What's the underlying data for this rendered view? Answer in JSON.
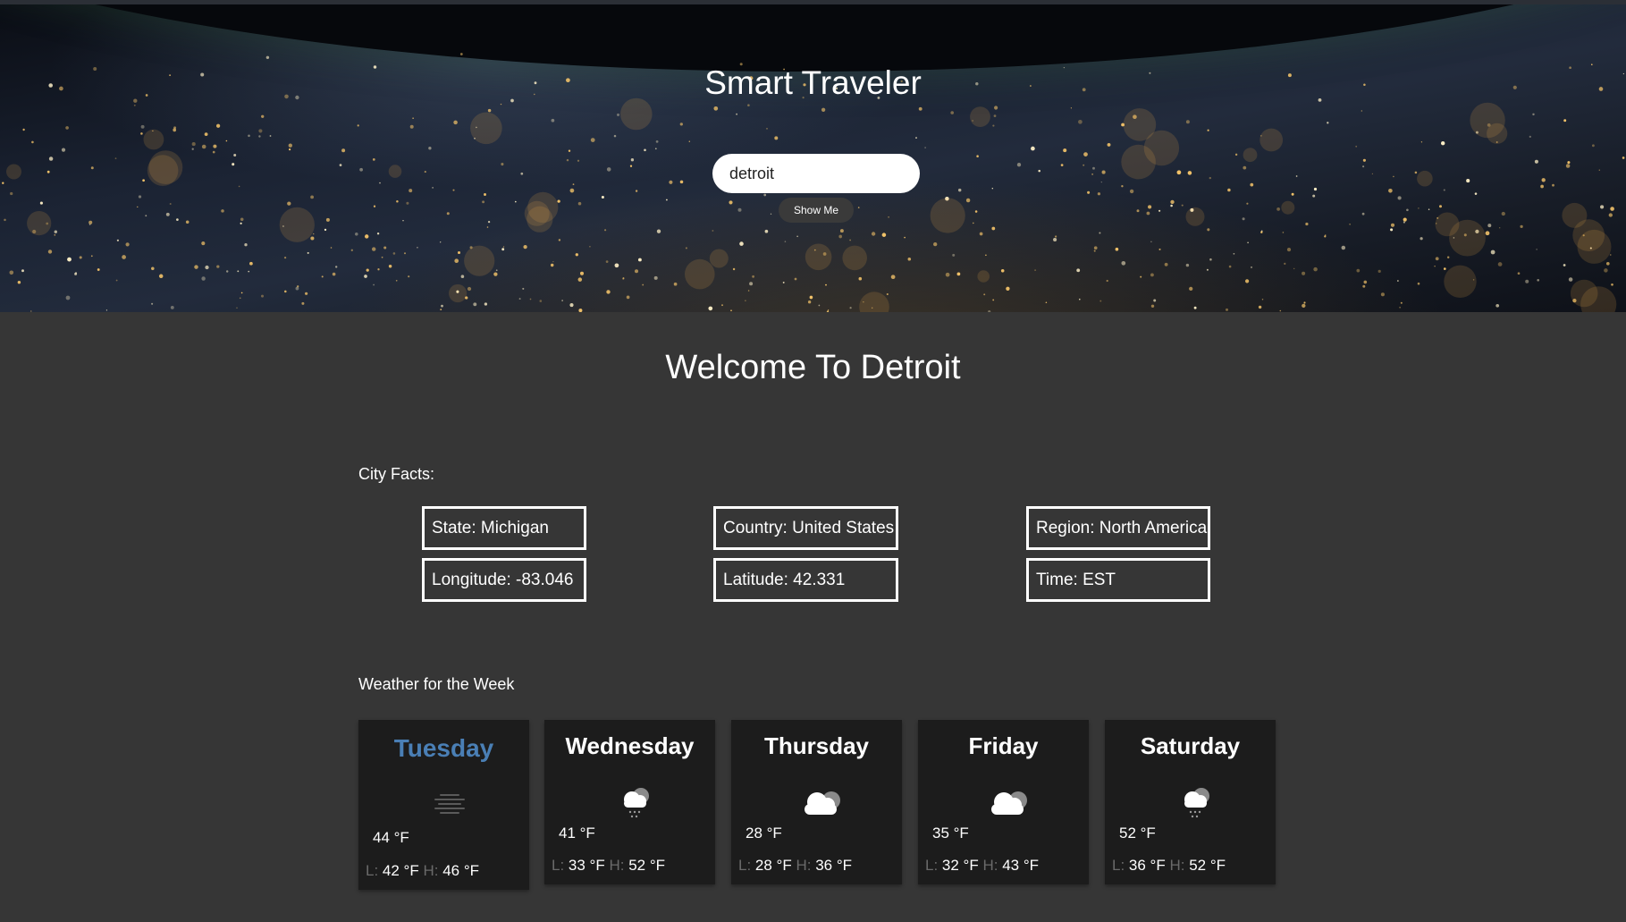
{
  "header": {
    "title": "Smart Traveler",
    "search_value": "detroit",
    "button_label": "Show Me"
  },
  "main": {
    "welcome": "Welcome To Detroit",
    "facts_label": "City Facts:",
    "facts": [
      "State: Michigan",
      "Country: United States",
      "Region: North America",
      "Longitude: -83.046",
      "Latitude: 42.331",
      "Time: EST"
    ],
    "weather_label": "Weather for the Week",
    "low_prefix": "L:",
    "high_prefix": "H:",
    "days": [
      {
        "name": "Tuesday",
        "temp": "44 °F",
        "low": "42 °F",
        "high": "46 °F",
        "icon": "fog-icon"
      },
      {
        "name": "Wednesday",
        "temp": "41 °F",
        "low": "33 °F",
        "high": "52 °F",
        "icon": "rain-cloud-icon"
      },
      {
        "name": "Thursday",
        "temp": "28 °F",
        "low": "28 °F",
        "high": "36 °F",
        "icon": "cloud-icon"
      },
      {
        "name": "Friday",
        "temp": "35 °F",
        "low": "32 °F",
        "high": "43 °F",
        "icon": "cloud-icon"
      },
      {
        "name": "Saturday",
        "temp": "52 °F",
        "low": "36 °F",
        "high": "52 °F",
        "icon": "rain-cloud-icon"
      }
    ]
  },
  "colors": {
    "background": "#363636",
    "card": "#1c1c1c",
    "accent_day": "#4a7fb5",
    "muted": "#6a6a6a"
  }
}
